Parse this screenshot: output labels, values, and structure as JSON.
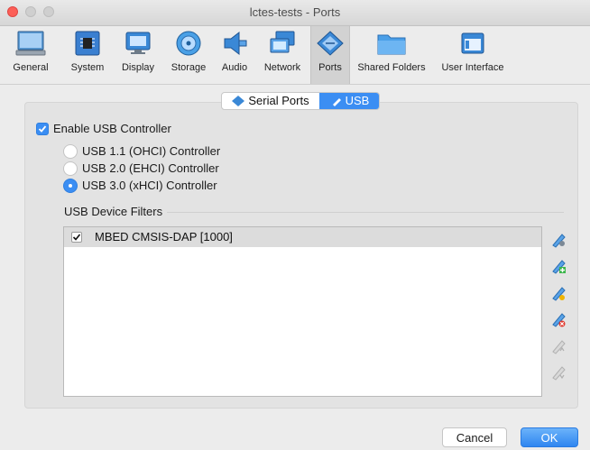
{
  "window": {
    "title": "lctes-tests - Ports"
  },
  "toolbar": {
    "items": [
      {
        "label": "General",
        "icon": "general-icon"
      },
      {
        "label": "System",
        "icon": "system-icon"
      },
      {
        "label": "Display",
        "icon": "display-icon"
      },
      {
        "label": "Storage",
        "icon": "storage-icon"
      },
      {
        "label": "Audio",
        "icon": "audio-icon"
      },
      {
        "label": "Network",
        "icon": "network-icon"
      },
      {
        "label": "Ports",
        "icon": "ports-icon",
        "active": true
      },
      {
        "label": "Shared Folders",
        "icon": "folder-icon"
      },
      {
        "label": "User Interface",
        "icon": "user-interface-icon"
      }
    ]
  },
  "tabs": {
    "serial": "Serial Ports",
    "usb": "USB",
    "selected": "USB"
  },
  "usb": {
    "enable_label": "Enable USB Controller",
    "enabled": true,
    "controllers": [
      {
        "label": "USB 1.1 (OHCI) Controller",
        "selected": false
      },
      {
        "label": "USB 2.0 (EHCI) Controller",
        "selected": false
      },
      {
        "label": "USB 3.0 (xHCI) Controller",
        "selected": true
      }
    ],
    "filters_title": "USB Device Filters",
    "filters": [
      {
        "label": "MBED CMSIS-DAP [1000]",
        "checked": true
      }
    ],
    "side_buttons": [
      "add-filter-icon",
      "add-from-device-icon",
      "edit-filter-icon",
      "remove-filter-icon",
      "move-up-icon",
      "move-down-icon"
    ]
  },
  "buttons": {
    "cancel": "Cancel",
    "ok": "OK"
  },
  "colors": {
    "accent": "#3b8ef3"
  }
}
